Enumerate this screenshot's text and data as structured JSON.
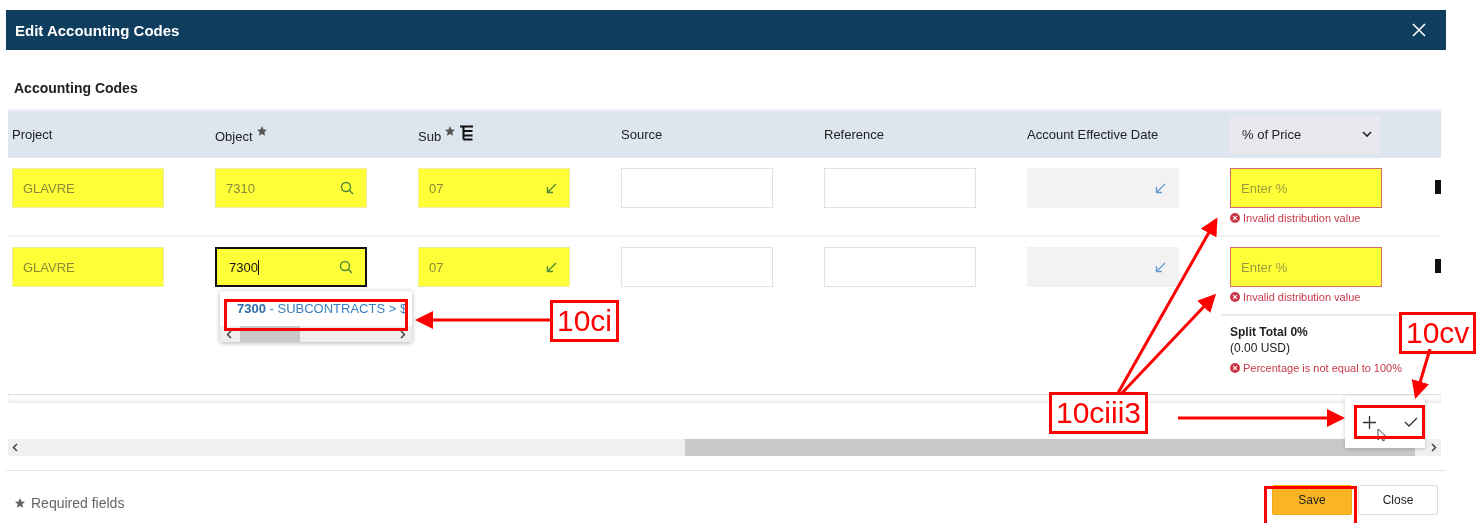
{
  "window": {
    "title": "Edit Accounting Codes"
  },
  "section_title": "Accounting Codes",
  "columns": [
    {
      "label": "Project",
      "required": false,
      "kind": "plain"
    },
    {
      "label": "Object",
      "required": true,
      "kind": "plain"
    },
    {
      "label": "Sub",
      "required": true,
      "kind": "tree"
    },
    {
      "label": "Source",
      "required": false,
      "kind": "plain"
    },
    {
      "label": "Reference",
      "required": false,
      "kind": "plain"
    },
    {
      "label": "Account Effective Date",
      "required": false,
      "kind": "plain"
    },
    {
      "label": "% of Price",
      "required": false,
      "kind": "dropdown"
    }
  ],
  "rows": [
    {
      "cells": [
        {
          "kind": "text",
          "value": "GLAVRE",
          "highlighted": true,
          "focused": false
        },
        {
          "kind": "search",
          "value": "7310",
          "highlighted": true,
          "focused": false
        },
        {
          "kind": "lookup",
          "value": "07",
          "highlighted": true,
          "focused": false
        },
        {
          "kind": "text",
          "highlighted": false,
          "focused": false
        },
        {
          "kind": "text",
          "highlighted": false,
          "focused": false
        },
        {
          "kind": "date",
          "highlighted": false,
          "focused": false
        },
        {
          "kind": "percent",
          "placeholder": "Enter %",
          "highlighted": true,
          "focused": false,
          "error": "Invalid distribution value"
        }
      ]
    },
    {
      "cells": [
        {
          "kind": "text",
          "value": "GLAVRE",
          "highlighted": true,
          "focused": false
        },
        {
          "kind": "search",
          "value": "7300",
          "highlighted": true,
          "focused": true
        },
        {
          "kind": "lookup",
          "value": "07",
          "highlighted": true,
          "focused": false
        },
        {
          "kind": "text",
          "highlighted": false,
          "focused": false
        },
        {
          "kind": "text",
          "highlighted": false,
          "focused": false
        },
        {
          "kind": "date",
          "highlighted": false,
          "focused": false
        },
        {
          "kind": "percent",
          "placeholder": "Enter %",
          "highlighted": true,
          "focused": false,
          "error": "Invalid distribution value"
        }
      ]
    }
  ],
  "suggestions": [
    "**7300** - SUBCONTRACTS > $"
  ],
  "split_total": {
    "title": "Split Total 0%",
    "amount": "(0.00 USD)",
    "error": "Percentage is not equal to 100%"
  },
  "footer": {
    "note": "Required fields",
    "buttons": [
      {
        "label": "Save",
        "kind": "primary"
      },
      {
        "label": "Close",
        "kind": "secondary"
      }
    ]
  },
  "annotations": [
    {
      "label": "10ci"
    },
    {
      "label": "10ciii3"
    },
    {
      "label": "10cv"
    }
  ]
}
